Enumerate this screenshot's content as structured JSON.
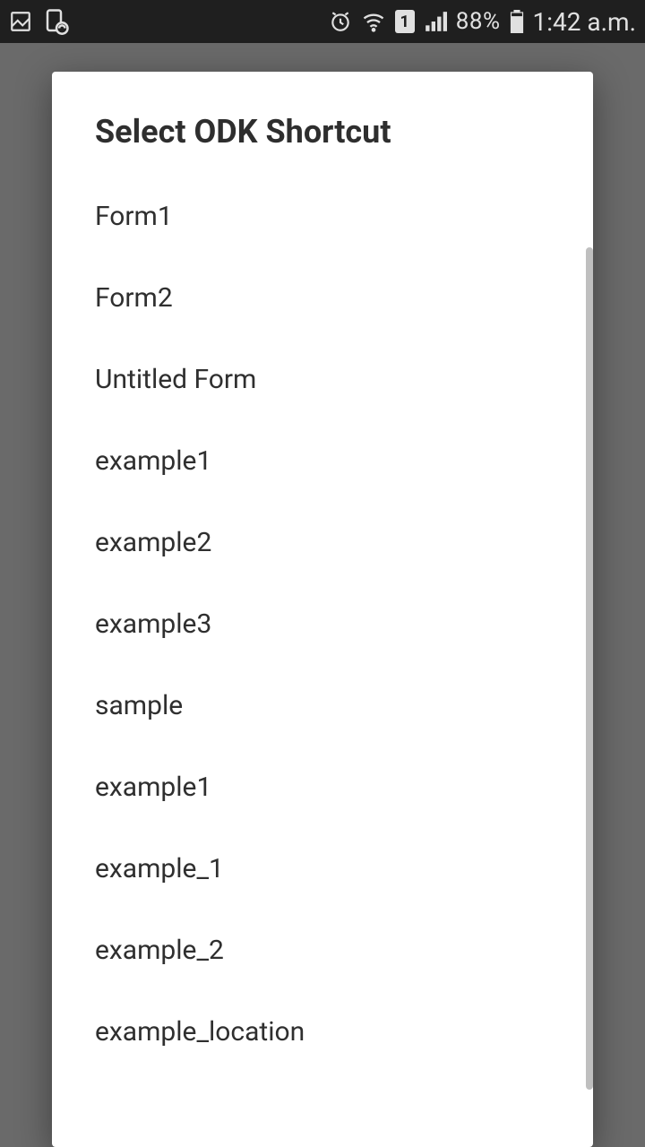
{
  "status_bar": {
    "battery_percent": "88%",
    "clock": "1:42 a.m.",
    "sim_number": "1"
  },
  "dialog": {
    "title": "Select ODK Shortcut",
    "items": [
      "Form1",
      "Form2",
      "Untitled Form",
      "example1",
      "example2",
      "example3",
      "sample",
      "example1",
      "example_1",
      "example_2",
      "example_location"
    ]
  }
}
